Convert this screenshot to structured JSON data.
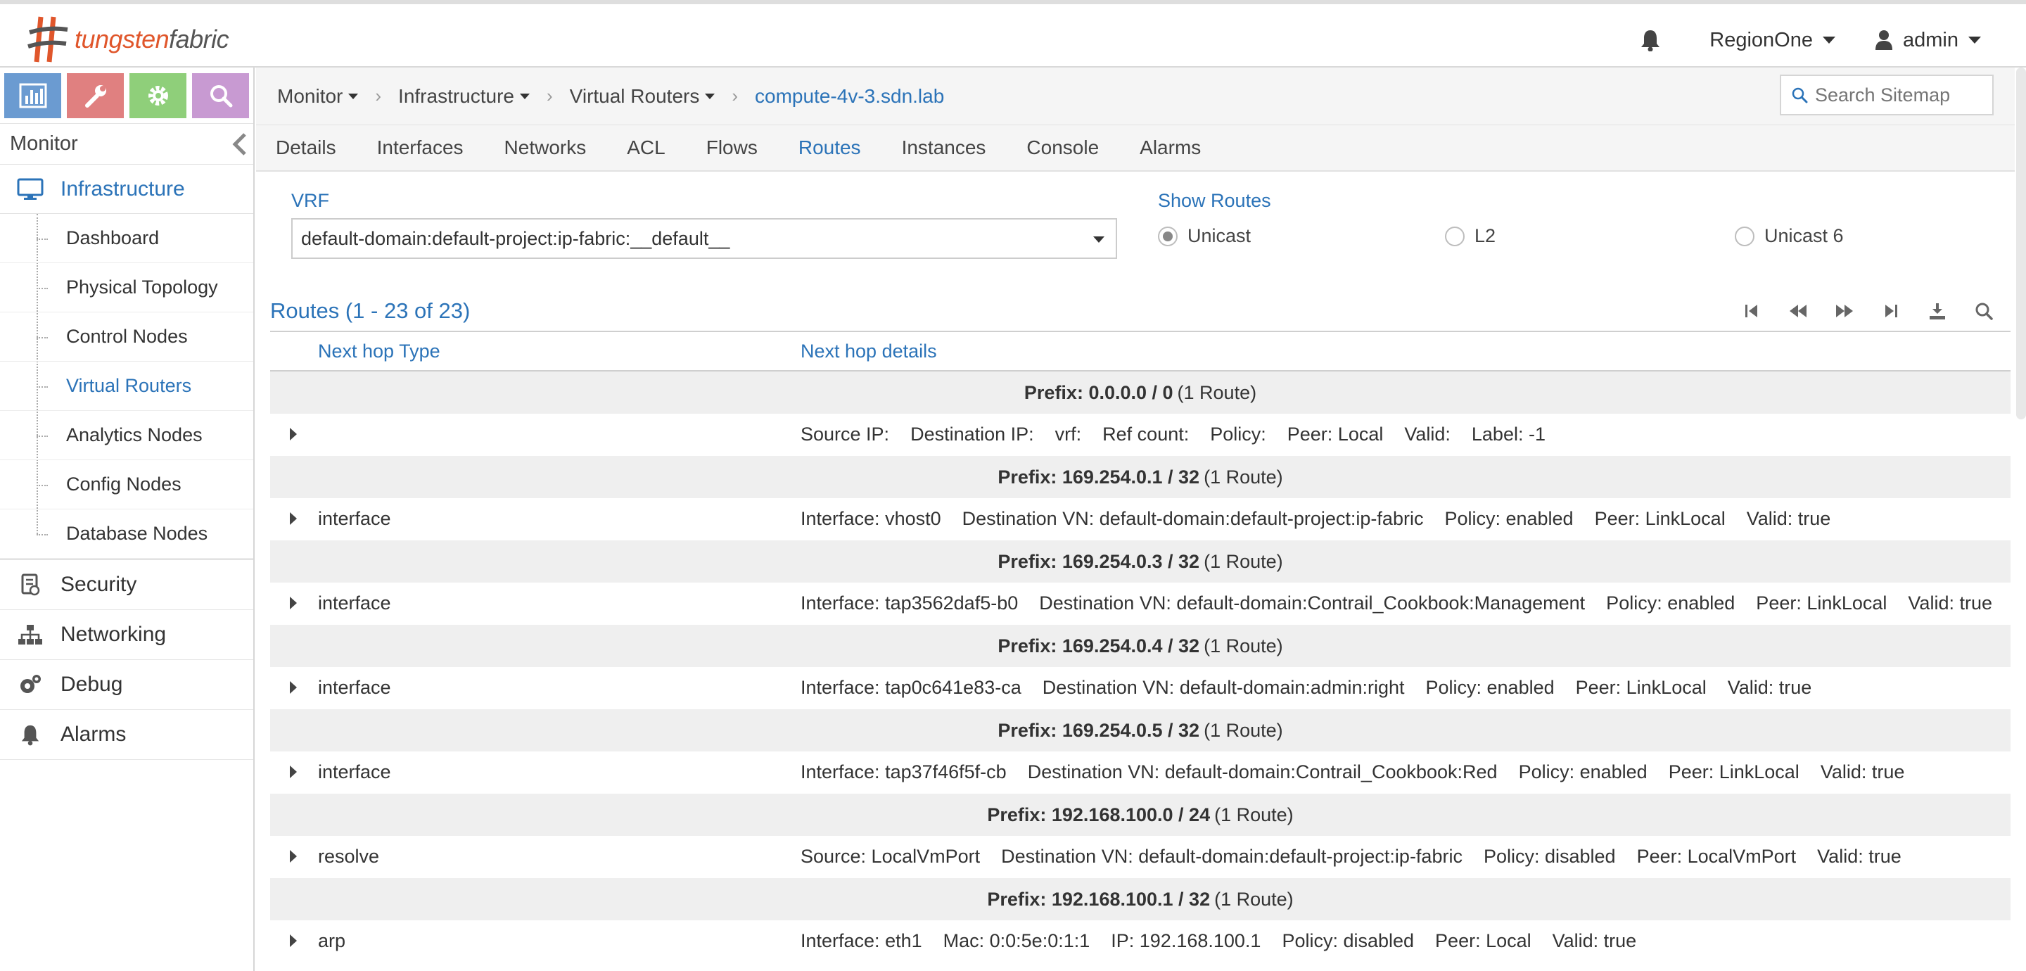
{
  "brand": {
    "name_part1": "tungsten",
    "name_part2": "fabric",
    "accent": "#e0562b"
  },
  "topbar": {
    "region": "RegionOne",
    "user": "admin"
  },
  "sidebar": {
    "section_title": "Monitor",
    "infrastructure_label": "Infrastructure",
    "infra_items": [
      {
        "label": "Dashboard"
      },
      {
        "label": "Physical Topology"
      },
      {
        "label": "Control Nodes"
      },
      {
        "label": "Virtual Routers"
      },
      {
        "label": "Analytics Nodes"
      },
      {
        "label": "Config Nodes"
      },
      {
        "label": "Database Nodes"
      }
    ],
    "groups": [
      {
        "label": "Security",
        "icon": "security-icon"
      },
      {
        "label": "Networking",
        "icon": "networking-icon"
      },
      {
        "label": "Debug",
        "icon": "debug-icon"
      },
      {
        "label": "Alarms",
        "icon": "alarms-bell-icon"
      }
    ]
  },
  "breadcrumb": {
    "items": [
      "Monitor",
      "Infrastructure",
      "Virtual Routers"
    ],
    "current": "compute-4v-3.sdn.lab",
    "sep": "›"
  },
  "search": {
    "placeholder": "Search Sitemap"
  },
  "tabs": [
    "Details",
    "Interfaces",
    "Networks",
    "ACL",
    "Flows",
    "Routes",
    "Instances",
    "Console",
    "Alarms"
  ],
  "active_tab": "Routes",
  "filters": {
    "vrf_label": "VRF",
    "vrf_value": "default-domain:default-project:ip-fabric:__default__",
    "show_routes_label": "Show Routes",
    "options": [
      {
        "label": "Unicast",
        "selected": true
      },
      {
        "label": "L2",
        "selected": false
      },
      {
        "label": "Unicast 6",
        "selected": false
      }
    ]
  },
  "grid": {
    "title": "Routes (1 - 23 of 23)",
    "col_type": "Next hop Type",
    "col_details": "Next hop details"
  },
  "routes": [
    {
      "prefix": "Prefix: 0.0.0.0 / 0",
      "count": "(1 Route)",
      "type": "",
      "details": "Source IP:    Destination IP:    vrf:    Ref count:    Policy:    Peer: Local    Valid:    Label: -1"
    },
    {
      "prefix": "Prefix: 169.254.0.1 / 32",
      "count": "(1 Route)",
      "type": "interface",
      "details": "Interface: vhost0    Destination VN: default-domain:default-project:ip-fabric    Policy: enabled    Peer: LinkLocal    Valid: true"
    },
    {
      "prefix": "Prefix: 169.254.0.3 / 32",
      "count": "(1 Route)",
      "type": "interface",
      "details": "Interface: tap3562daf5-b0    Destination VN: default-domain:Contrail_Cookbook:Management    Policy: enabled    Peer: LinkLocal    Valid: true"
    },
    {
      "prefix": "Prefix: 169.254.0.4 / 32",
      "count": "(1 Route)",
      "type": "interface",
      "details": "Interface: tap0c641e83-ca    Destination VN: default-domain:admin:right    Policy: enabled    Peer: LinkLocal    Valid: true"
    },
    {
      "prefix": "Prefix: 169.254.0.5 / 32",
      "count": "(1 Route)",
      "type": "interface",
      "details": "Interface: tap37f46f5f-cb    Destination VN: default-domain:Contrail_Cookbook:Red    Policy: enabled    Peer: LinkLocal    Valid: true"
    },
    {
      "prefix": "Prefix: 192.168.100.0 / 24",
      "count": "(1 Route)",
      "type": "resolve",
      "details": "Source: LocalVmPort    Destination VN: default-domain:default-project:ip-fabric    Policy: disabled    Peer: LocalVmPort    Valid: true"
    },
    {
      "prefix": "Prefix: 192.168.100.1 / 32",
      "count": "(1 Route)",
      "type": "arp",
      "details": "Interface: eth1    Mac: 0:0:5e:0:1:1    IP: 192.168.100.1    Policy: disabled    Peer: Local    Valid: true"
    }
  ]
}
